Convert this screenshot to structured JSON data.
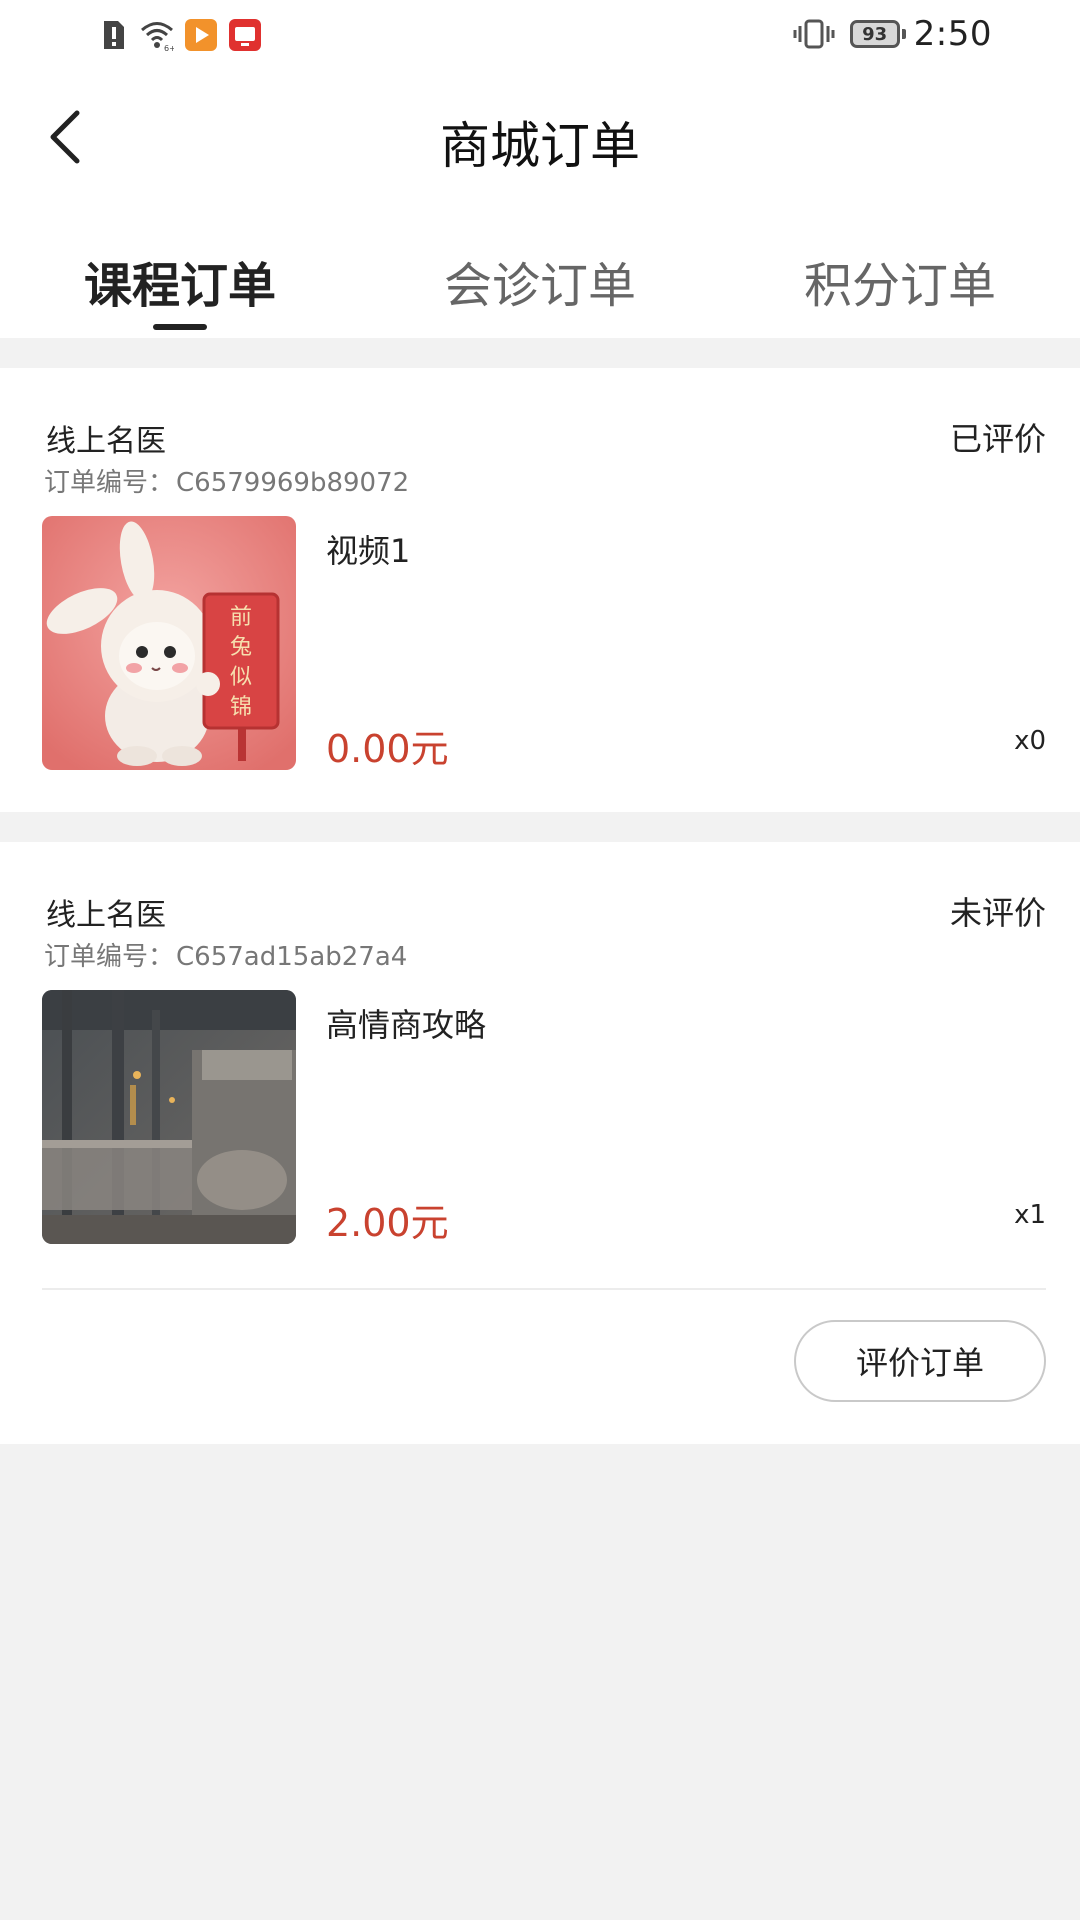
{
  "status_bar": {
    "battery": "93",
    "time": "2:50"
  },
  "nav": {
    "title": "商城订单"
  },
  "tabs": [
    {
      "label": "课程订单",
      "active": true
    },
    {
      "label": "会诊订单",
      "active": false
    },
    {
      "label": "积分订单",
      "active": false
    }
  ],
  "orders": [
    {
      "shop": "线上名医",
      "status": "已评价",
      "order_no_label": "订单编号：",
      "order_no": "C6579969b89072",
      "product": "视频1",
      "price": "0.00元",
      "qty": "x0",
      "thumbnail_icon": "bunny-sign-illustration",
      "sign_text": "前兔似锦"
    },
    {
      "shop": "线上名医",
      "status": "未评价",
      "order_no_label": "订单编号：",
      "order_no": "C657ad15ab27a4",
      "product": "高情商攻略",
      "price": "2.00元",
      "qty": "x1",
      "thumbnail_icon": "industrial-photo",
      "action_label": "评价订单"
    }
  ],
  "colors": {
    "price": "#c9422f",
    "background": "#f2f2f2",
    "card": "#ffffff"
  }
}
